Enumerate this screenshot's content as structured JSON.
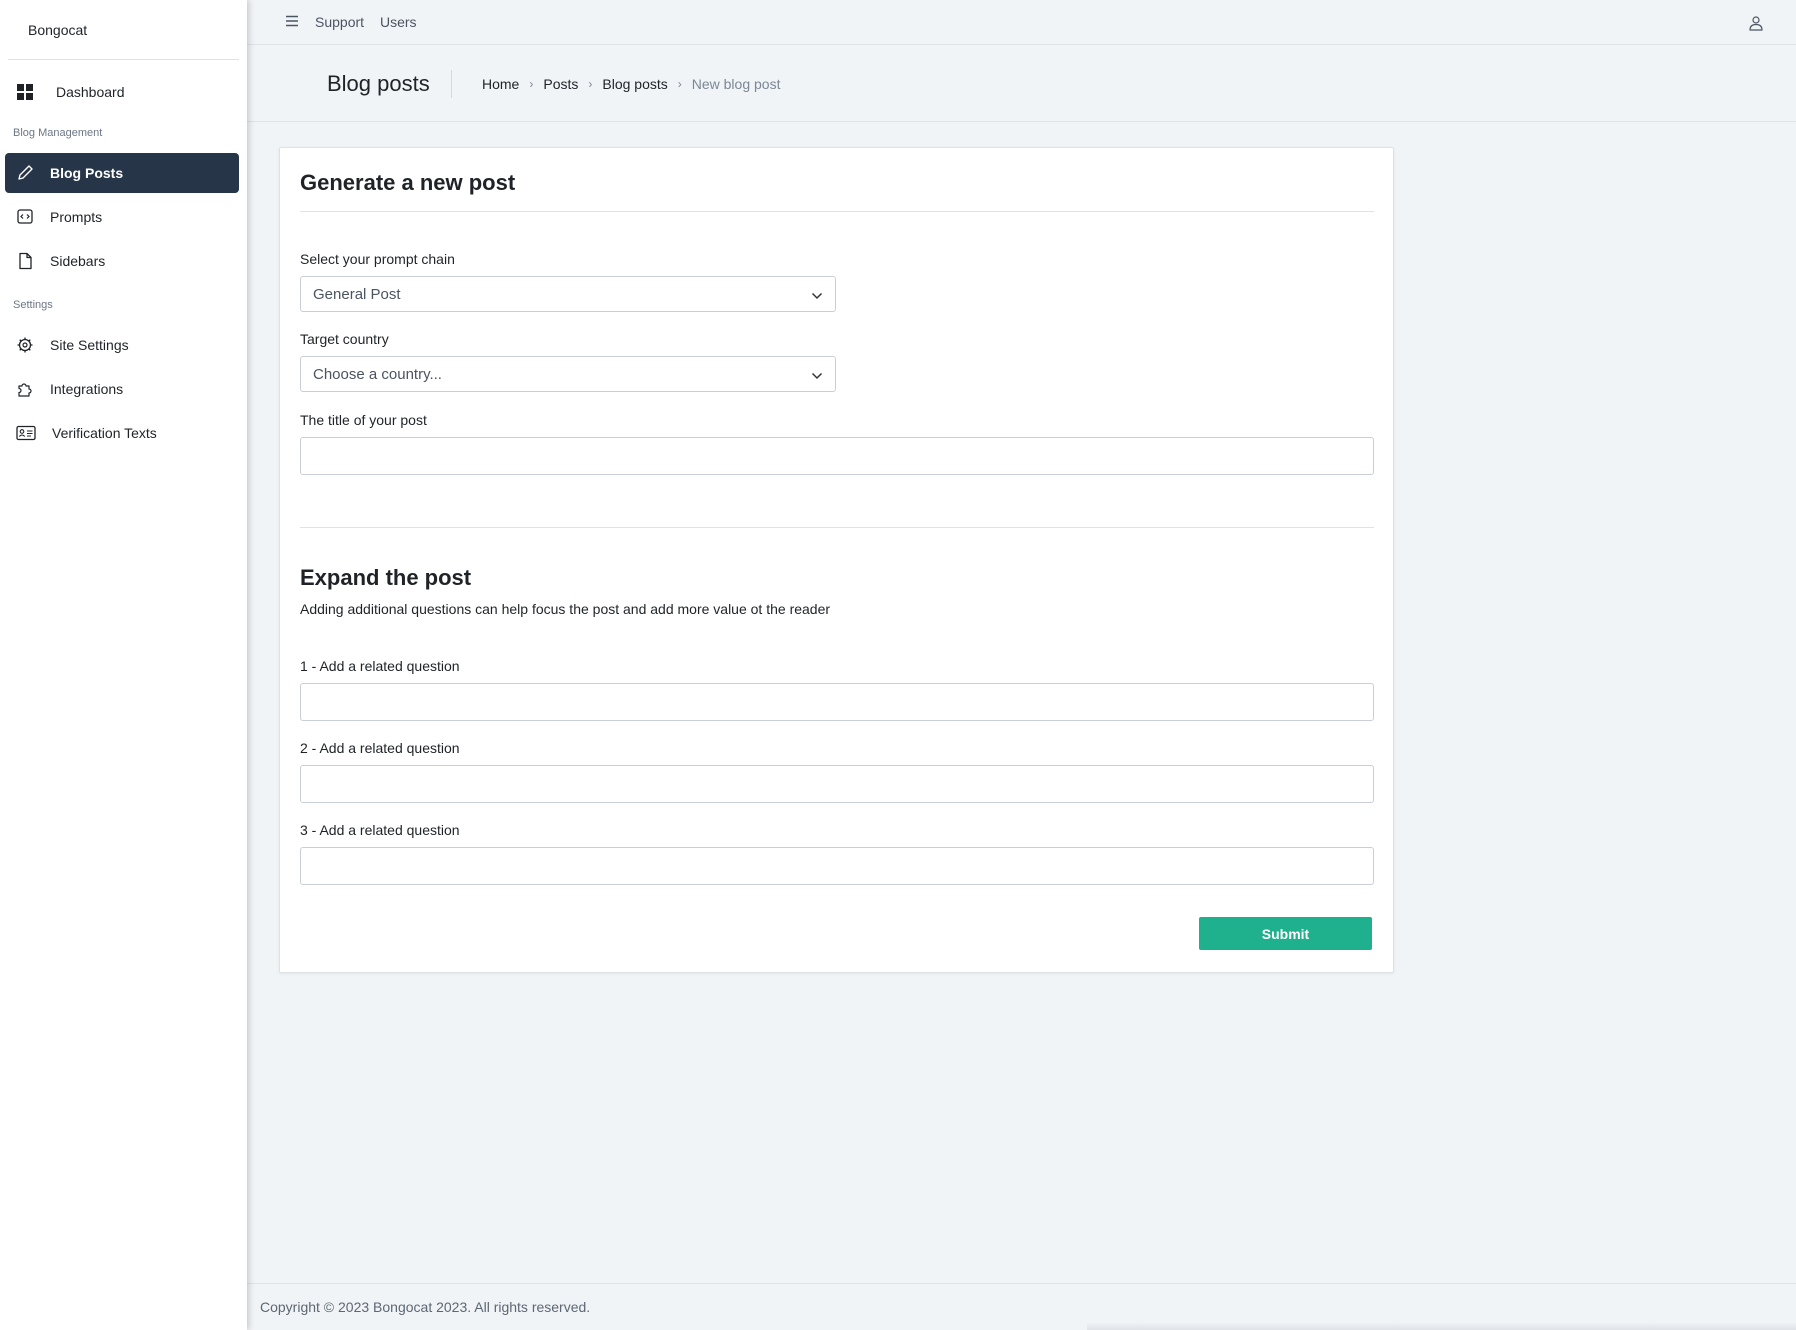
{
  "brand": "Bongocat",
  "sidebar": {
    "items": [
      {
        "label": "Dashboard",
        "icon": "dashboard-icon"
      },
      {
        "label": "Blog Posts",
        "icon": "pencil-icon",
        "active": true
      },
      {
        "label": "Prompts",
        "icon": "code-icon"
      },
      {
        "label": "Sidebars",
        "icon": "file-icon"
      },
      {
        "label": "Site Settings",
        "icon": "gear-icon"
      },
      {
        "label": "Integrations",
        "icon": "puzzle-icon"
      },
      {
        "label": "Verification Texts",
        "icon": "id-card-icon"
      }
    ],
    "sections": [
      "Blog Management",
      "Settings"
    ]
  },
  "topbar": {
    "links": [
      "Support",
      "Users"
    ]
  },
  "header": {
    "title": "Blog posts",
    "breadcrumb": [
      "Home",
      "Posts",
      "Blog posts",
      "New blog post"
    ]
  },
  "form": {
    "title": "Generate a new post",
    "prompt_chain_label": "Select your prompt chain",
    "prompt_chain_value": "General Post",
    "country_label": "Target country",
    "country_placeholder": "Choose a country...",
    "post_title_label": "The title of your post",
    "post_title_value": "",
    "expand_title": "Expand the post",
    "expand_desc": "Adding additional questions can help focus the post and add more value ot the reader",
    "questions": [
      {
        "label": "1 - Add a related question",
        "value": ""
      },
      {
        "label": "2 - Add a related question",
        "value": ""
      },
      {
        "label": "3 - Add a related question",
        "value": ""
      }
    ],
    "submit_label": "Submit"
  },
  "footer": "Copyright © 2023 Bongocat 2023. All rights reserved.",
  "colors": {
    "sidebar_active": "#263547",
    "submit": "#1fb08e",
    "background": "#f1f4f7"
  }
}
